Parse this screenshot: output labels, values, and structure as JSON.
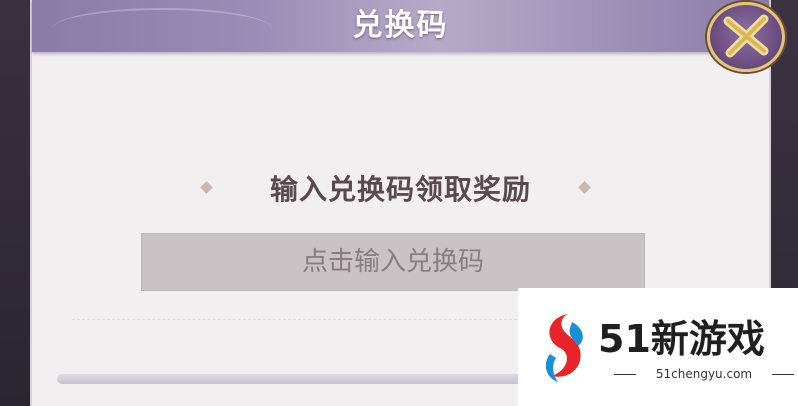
{
  "dialog": {
    "title": "兑换码",
    "instruction": "输入兑换码领取奖励",
    "input_placeholder": "点击输入兑换码"
  },
  "close_button": {
    "icon": "close-x-icon"
  },
  "colors": {
    "header": "#9a8cb5",
    "dialog_bg": "#f1eff0",
    "input_bg": "#c9c3c5",
    "close_gold": "#e2c47c"
  },
  "watermark": {
    "brand": "51新游戏",
    "url": "51chengyu.com",
    "logo": "51-logo"
  }
}
